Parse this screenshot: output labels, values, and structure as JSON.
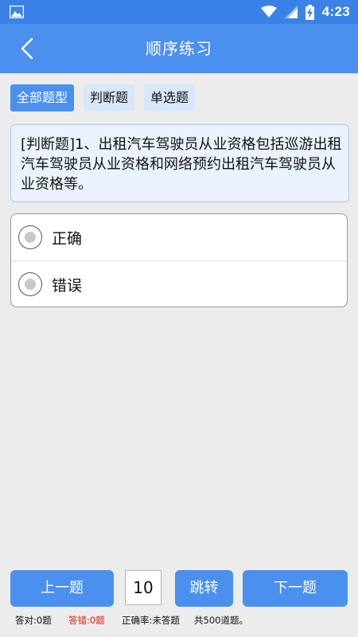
{
  "status_bar": {
    "time": "4:23",
    "icons": [
      "image-icon",
      "wifi-icon",
      "signal-icon",
      "battery-charging-icon"
    ]
  },
  "app_bar": {
    "title": "顺序练习",
    "back_icon": "chevron-left-icon"
  },
  "filters": [
    {
      "label": "全部题型",
      "active": true
    },
    {
      "label": "判断题",
      "active": false
    },
    {
      "label": "单选题",
      "active": false
    }
  ],
  "question": {
    "text": "[判断题]1、出租汽车驾驶员从业资格包括巡游出租汽车驾驶员从业资格和网络预约出租汽车驾驶员从业资格等。"
  },
  "options": [
    {
      "label": "正确"
    },
    {
      "label": "错误"
    }
  ],
  "navigation": {
    "prev_label": "上一题",
    "page_value": "10",
    "jump_label": "跳转",
    "next_label": "下一题"
  },
  "stats": {
    "correct": "答对:0题",
    "wrong": "答错:0题",
    "rate": "正确率:未答题",
    "total": "共500道题。"
  },
  "colors": {
    "primary": "#4a90ee",
    "status_bar": "#3b82e8",
    "chip_inactive": "#d8e8fb",
    "wrong_text": "#e02020"
  }
}
